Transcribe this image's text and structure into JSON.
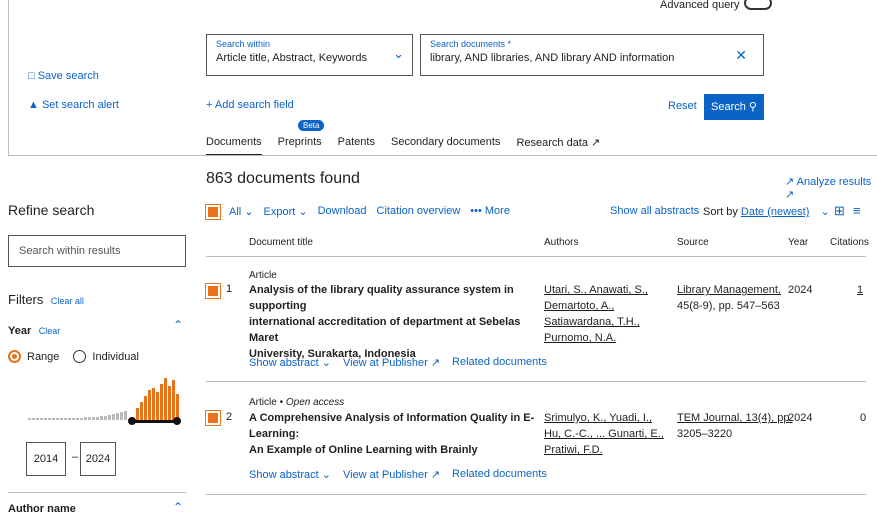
{
  "advanced_query": "Advanced query",
  "sidebar_top": {
    "save_search": "Save search",
    "set_alert": "Set search alert"
  },
  "search": {
    "within_label": "Search within",
    "within_value": "Article title, Abstract, Keywords",
    "docs_label": "Search documents *",
    "docs_value": "library, AND libraries, AND library AND information",
    "add_field": "Add search field",
    "reset": "Reset",
    "search_btn": "Search"
  },
  "tabs": {
    "documents": "Documents",
    "preprints": "Preprints",
    "beta": "Beta",
    "patents": "Patents",
    "secondary": "Secondary documents",
    "research": "Research data ↗"
  },
  "results": {
    "count": "863 documents found",
    "analyze": "Analyze results ↗"
  },
  "toolbar": {
    "all": "All",
    "export": "Export",
    "download": "Download",
    "citation": "Citation overview",
    "more": "More",
    "show_abstracts": "Show all abstracts",
    "sort_label": "Sort by",
    "sort_value": "Date (newest)"
  },
  "columns": {
    "title": "Document title",
    "authors": "Authors",
    "source": "Source",
    "year": "Year",
    "citations": "Citations"
  },
  "refine": {
    "heading": "Refine search",
    "search_placeholder": "Search within results",
    "filters": "Filters",
    "clear_all": "Clear all",
    "year": "Year",
    "clear": "Clear",
    "range": "Range",
    "individual": "Individual",
    "year_from": "2014",
    "year_sep": "–",
    "year_to": "2024",
    "author_name": "Author name"
  },
  "docs": [
    {
      "num": "1",
      "type": "Article",
      "access": "",
      "title_lines": [
        "Analysis of the library quality assurance system in supporting",
        "international accreditation of department at Sebelas Maret",
        "University, Surakarta, Indonesia"
      ],
      "author_lines": [
        "Utari, S., Anawati, S.,",
        "Demartoto, A.,",
        "Satiawardana, T.H.,",
        "Purnomo, N.A."
      ],
      "source_lines": [
        "Library Management,",
        "45(8-9), pp. 547–563"
      ],
      "year": "2024",
      "citations": "1"
    },
    {
      "num": "2",
      "type": "Article",
      "access": "Open access",
      "title_lines": [
        "A Comprehensive Analysis of Information Quality in E-Learning:",
        "An Example of Online Learning with Brainly"
      ],
      "author_lines": [
        "Srimulyo, K., Yuadi, I.,",
        "Hu, C.-C., ... Gunarti, E.,",
        "Pratiwi, F.D."
      ],
      "source_lines": [
        "TEM Journal, 13(4), pp.",
        "3205–3220"
      ],
      "year": "2024",
      "citations": "0"
    }
  ],
  "row_actions": {
    "show_abstract": "Show abstract",
    "view_publisher": "View at Publisher ↗",
    "related": "Related documents"
  },
  "colors": {
    "accent": "#0b63c5",
    "orange": "#e8731a"
  }
}
